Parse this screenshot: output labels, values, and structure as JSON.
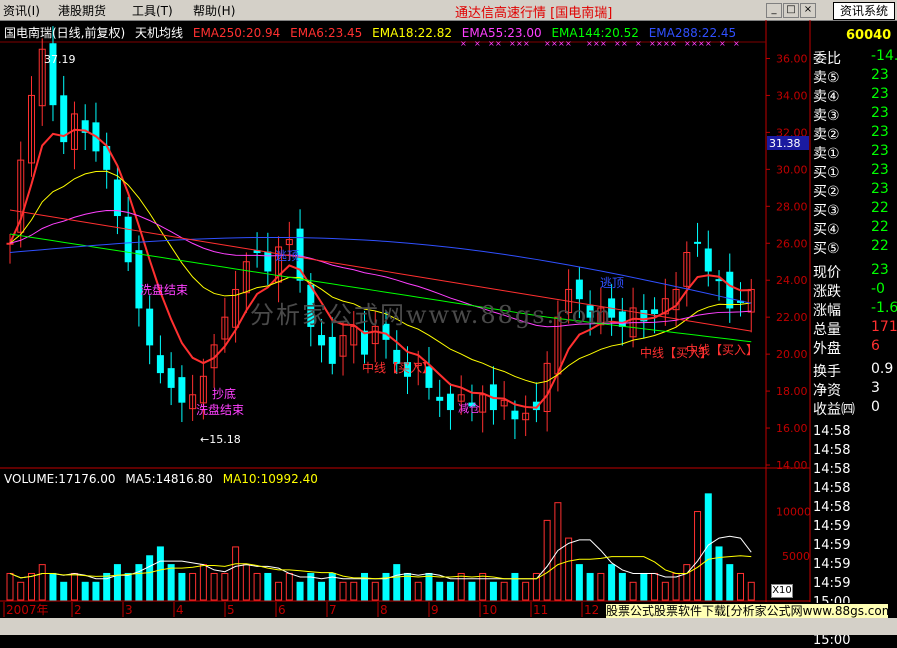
{
  "menu": {
    "items": [
      {
        "label": "资讯(I)",
        "x": 3
      },
      {
        "label": "港股期货",
        "x": 58
      },
      {
        "label": "工具(T)",
        "x": 132
      },
      {
        "label": "帮助(H)",
        "x": 193
      }
    ],
    "title": "通达信高速行情 [国电南瑞]",
    "sys_button": "资讯系统"
  },
  "chart_header": {
    "stock": "国电南瑞(日线,前复权)",
    "indicator": "天机均线",
    "emas": [
      {
        "label": "EMA250:20.94",
        "color": "#ff3030"
      },
      {
        "label": "EMA6:23.45",
        "color": "#ff3030"
      },
      {
        "label": "EMA18:22.82",
        "color": "#ffff00"
      },
      {
        "label": "EMA55:23.00",
        "color": "#ff40ff"
      },
      {
        "label": "EMA144:20.52",
        "color": "#00ff00"
      },
      {
        "label": "EMA288:22.45",
        "color": "#3050ff"
      }
    ]
  },
  "volume_header": [
    {
      "label": "VOLUME:17176.00",
      "color": "#ffffff"
    },
    {
      "label": "MA5:14816.80",
      "color": "#ffffff"
    },
    {
      "label": "MA10:10992.40",
      "color": "#ffff00"
    }
  ],
  "price_axis": [
    "36.00",
    "34.00",
    "32.00",
    "30.00",
    "28.00",
    "26.00",
    "24.00",
    "22.00",
    "20.00",
    "18.00",
    "16.00",
    "14.00"
  ],
  "current_price_tag": "31.38",
  "volume_axis": [
    "10000",
    "5000"
  ],
  "volume_scale_button": "X10",
  "months": [
    "2007年",
    "2",
    "3",
    "4",
    "5",
    "6",
    "7",
    "8",
    "9",
    "10",
    "11",
    "12"
  ],
  "annotations": {
    "high": "37.19",
    "low": "15.18",
    "xipan1": "洗盘结束",
    "xipan2": "洗盘结束",
    "chaodi": "抄底",
    "taopao1": "逃顶",
    "taopao2": "逃顶",
    "zhongxian1": "中线【买入】",
    "zhongxian2": "中线【买入】",
    "zhongxian3": "中线【买入】",
    "jiancang": "减仓"
  },
  "watermark": "分析家公式网www.88gs.com",
  "right_panel": {
    "code": "60040",
    "rows": [
      {
        "label": "委比",
        "value": "-14.1"
      },
      {
        "label": "卖⑤",
        "value": "23"
      },
      {
        "label": "卖④",
        "value": "23"
      },
      {
        "label": "卖③",
        "value": "23"
      },
      {
        "label": "卖②",
        "value": "23"
      },
      {
        "label": "卖①",
        "value": "23"
      },
      {
        "label": "买①",
        "value": "23"
      },
      {
        "label": "买②",
        "value": "23"
      },
      {
        "label": "买③",
        "value": "22"
      },
      {
        "label": "买④",
        "value": "22"
      },
      {
        "label": "买⑤",
        "value": "22"
      },
      {
        "label": "现价",
        "value": "23"
      },
      {
        "label": "涨跌",
        "value": "-0"
      },
      {
        "label": "涨幅",
        "value": "-1.6"
      },
      {
        "label": "总量",
        "value": "171"
      },
      {
        "label": "外盘",
        "value": "6"
      },
      {
        "label": "换手",
        "value": "0.9"
      },
      {
        "label": "净资",
        "value": "3"
      },
      {
        "label": "收益㈣",
        "value": "0"
      }
    ],
    "times": [
      "14:58",
      "14:58",
      "14:58",
      "14:58",
      "14:58",
      "14:59",
      "14:59",
      "14:59",
      "14:59",
      "15:00",
      "15:00",
      "15:00"
    ]
  },
  "ad_text": "股票公式股票软件下载[分析家公式网www.88gs.com]",
  "colors": {
    "up": "#ff3030",
    "down": "#00ffff",
    "ema250": "#ff3030",
    "ema18": "#ffff00",
    "ema55": "#ff40ff",
    "ema144": "#00ff00",
    "ema288": "#3050ff",
    "axis": "#c00000"
  },
  "chart_data": {
    "type": "line",
    "title": "国电南瑞(日线,前复权) 天机均线",
    "x_range": [
      "2007-01",
      "2007-12"
    ],
    "y_range": [
      14,
      37
    ],
    "series": [
      {
        "name": "EMA250",
        "last": 20.94
      },
      {
        "name": "EMA6",
        "last": 23.45
      },
      {
        "name": "EMA18",
        "last": 22.82
      },
      {
        "name": "EMA55",
        "last": 23.0
      },
      {
        "name": "EMA144",
        "last": 20.52
      },
      {
        "name": "EMA288",
        "last": 22.45
      }
    ],
    "close_path": [
      [
        1,
        26.0
      ],
      [
        2,
        30.5
      ],
      [
        3,
        34.0
      ],
      [
        4,
        36.5
      ],
      [
        5,
        33.5
      ],
      [
        6,
        31.5
      ],
      [
        7,
        33.0
      ],
      [
        8,
        32.0
      ],
      [
        9,
        31.0
      ],
      [
        10,
        30.0
      ],
      [
        11,
        27.5
      ],
      [
        12,
        25.0
      ],
      [
        13,
        22.5
      ],
      [
        14,
        20.5
      ],
      [
        15,
        19.0
      ],
      [
        16,
        18.2
      ],
      [
        17,
        17.4
      ],
      [
        18,
        17.8
      ],
      [
        19,
        18.8
      ],
      [
        20,
        20.5
      ],
      [
        21,
        22.0
      ],
      [
        22,
        23.5
      ],
      [
        23,
        25.0
      ],
      [
        24,
        25.5
      ],
      [
        25,
        24.5
      ],
      [
        26,
        25.8
      ],
      [
        27,
        26.2
      ],
      [
        28,
        24.0
      ],
      [
        29,
        21.5
      ],
      [
        30,
        20.5
      ],
      [
        31,
        19.5
      ],
      [
        32,
        21.0
      ],
      [
        33,
        21.5
      ],
      [
        34,
        20.0
      ],
      [
        35,
        21.5
      ],
      [
        36,
        20.8
      ],
      [
        37,
        19.5
      ],
      [
        38,
        18.8
      ],
      [
        39,
        19.5
      ],
      [
        40,
        18.2
      ],
      [
        41,
        17.5
      ],
      [
        42,
        17.0
      ],
      [
        43,
        17.8
      ],
      [
        44,
        17.2
      ],
      [
        45,
        17.8
      ],
      [
        46,
        17.0
      ],
      [
        47,
        17.5
      ],
      [
        48,
        16.5
      ],
      [
        49,
        16.8
      ],
      [
        50,
        17.0
      ],
      [
        51,
        19.5
      ],
      [
        52,
        22.0
      ],
      [
        53,
        23.5
      ],
      [
        54,
        23.0
      ],
      [
        55,
        22.0
      ],
      [
        56,
        22.5
      ],
      [
        57,
        22.0
      ],
      [
        58,
        21.5
      ],
      [
        59,
        22.5
      ],
      [
        60,
        21.8
      ],
      [
        61,
        22.2
      ],
      [
        62,
        23.0
      ],
      [
        63,
        23.5
      ],
      [
        64,
        25.5
      ],
      [
        65,
        26.0
      ],
      [
        66,
        24.5
      ],
      [
        67,
        24.0
      ],
      [
        68,
        22.5
      ],
      [
        69,
        22.8
      ],
      [
        70,
        23.5
      ]
    ],
    "volume": [
      3,
      2,
      3,
      4,
      3,
      2,
      3,
      2,
      2,
      3,
      4,
      3,
      4,
      5,
      6,
      4,
      3,
      3,
      4,
      3,
      3,
      6,
      4,
      3,
      3,
      2,
      3,
      2,
      3,
      2,
      3,
      2,
      2,
      3,
      2,
      3,
      4,
      3,
      2,
      3,
      2,
      2,
      3,
      2,
      3,
      2,
      2,
      3,
      2,
      3,
      9,
      11,
      7,
      4,
      3,
      3,
      4,
      3,
      2,
      3,
      3,
      2,
      3,
      4,
      10,
      12,
      6,
      4,
      3,
      2
    ],
    "vol_ylim": [
      0,
      13000
    ]
  }
}
